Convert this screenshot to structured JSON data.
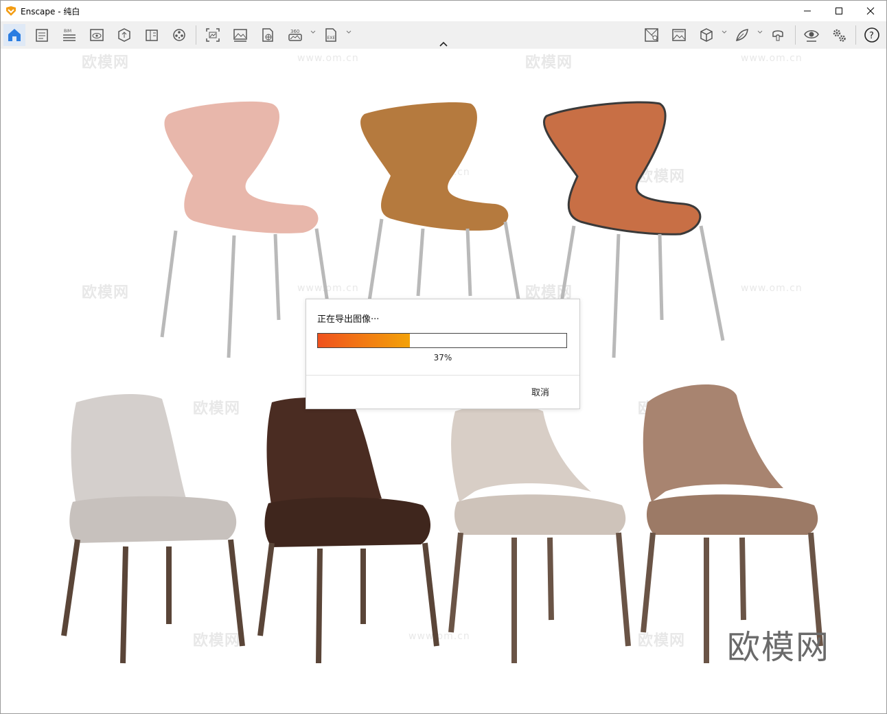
{
  "window": {
    "title": "Enscape - 纯白",
    "accent": "#F39C12"
  },
  "toolbar": {
    "left_icons": [
      "home-icon",
      "document-settings-icon",
      "bim-icon",
      "visual-preview-icon",
      "asset-library-icon",
      "material-editor-icon",
      "video-editor-icon",
      "render-screenshot-icon",
      "batch-render-icon",
      "web-standalone-icon",
      "render-360-icon",
      "export-exe-icon"
    ],
    "right_icons": [
      "view-management-icon",
      "capture-image-icon",
      "cube-view-icon",
      "feather-light-icon",
      "vr-headset-icon",
      "eye-visual-settings-icon",
      "settings-gears-icon",
      "help-icon"
    ],
    "bim_label": "BIM",
    "pano_label": "360",
    "exe_label": "EXE",
    "help_label": "?"
  },
  "viewport": {
    "watermark_large": "欧模网",
    "watermark_small": "www.om.cn",
    "brand": "欧模网"
  },
  "export_dialog": {
    "title": "正在导出图像···",
    "progress": 0.37,
    "percent_text": "37%",
    "cancel_label": "取消",
    "bar_color_start": "#F0521E",
    "bar_color_end": "#F3A209"
  }
}
